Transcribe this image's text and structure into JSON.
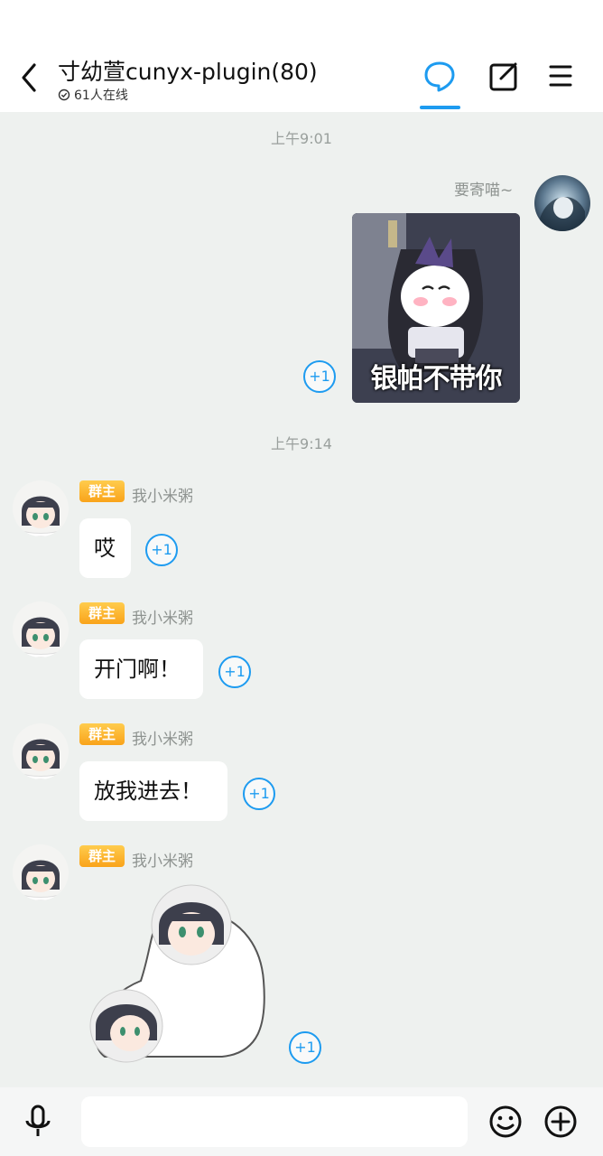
{
  "header": {
    "title": "寸幼萱cunyx-plugin(80)",
    "online": "61人在线",
    "accent": "#1d9bf0"
  },
  "messages": [
    {
      "time": "上午9:01"
    },
    {
      "side": "right",
      "nickname": "要寄喵~",
      "type": "sticker",
      "sticker_caption": "银帕不带你",
      "plus": "+1"
    },
    {
      "time": "上午9:14"
    },
    {
      "side": "left",
      "badge": "群主",
      "nickname": "我小米粥",
      "text": "哎",
      "plus": "+1"
    },
    {
      "side": "left",
      "badge": "群主",
      "nickname": "我小米粥",
      "text": "开门啊！",
      "plus": "+1"
    },
    {
      "side": "left",
      "badge": "群主",
      "nickname": "我小米粥",
      "text": "放我进去！",
      "plus": "+1"
    },
    {
      "side": "left",
      "badge": "群主",
      "nickname": "我小米粥",
      "type": "sticker",
      "plus": "+1"
    }
  ],
  "icons": {
    "back": "back-arrow-icon",
    "chat": "chat-bubble-icon",
    "edit": "edit-icon",
    "menu": "menu-icon",
    "mic": "microphone-icon",
    "emoji": "emoji-icon",
    "add": "plus-circle-icon"
  }
}
